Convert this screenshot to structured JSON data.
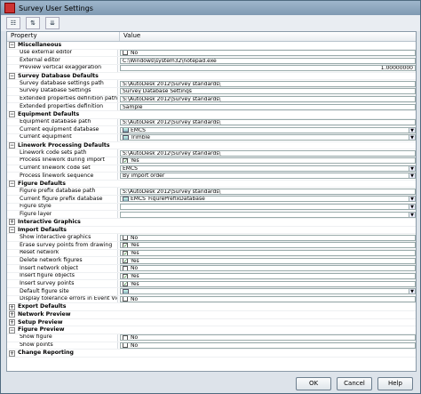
{
  "window": {
    "title": "Survey User Settings"
  },
  "toolbar": {
    "btn1": "☷",
    "btn2": "⇅",
    "btn3": "⇊"
  },
  "grid": {
    "col_property": "Property",
    "col_value": "Value"
  },
  "rows": [
    {
      "type": "cat",
      "label": "Miscellaneous",
      "exp": "−"
    },
    {
      "type": "prop",
      "label": "Use external editor",
      "kind": "check",
      "checked": false,
      "value": "No"
    },
    {
      "type": "prop",
      "label": "External editor",
      "kind": "text",
      "value": "C:\\Windows\\system32\\notepad.exe"
    },
    {
      "type": "prop",
      "label": "Preview vertical exaggeration",
      "kind": "num",
      "value": "1.00000000"
    },
    {
      "type": "cat",
      "label": "Survey Database Defaults",
      "exp": "−"
    },
    {
      "type": "prop",
      "label": "Survey database settings path",
      "kind": "text",
      "value": "S:\\AutoDesk 2012\\Survey standards\\"
    },
    {
      "type": "prop",
      "label": "Survey Database Settings",
      "kind": "text",
      "value": "Survey Database Settings"
    },
    {
      "type": "prop",
      "label": "Extended properties definition path",
      "kind": "text",
      "value": "S:\\AutoDesk 2012\\Survey standards\\"
    },
    {
      "type": "prop",
      "label": "Extended properties definition",
      "kind": "text",
      "value": "Sample"
    },
    {
      "type": "cat",
      "label": "Equipment Defaults",
      "exp": "−"
    },
    {
      "type": "prop",
      "label": "Equipment database path",
      "kind": "text",
      "value": "S:\\AutoDesk 2012\\Survey standards\\"
    },
    {
      "type": "prop",
      "label": "Current equipment database",
      "kind": "icondd",
      "value": "EMCS"
    },
    {
      "type": "prop",
      "label": "Current equipment",
      "kind": "icondd",
      "value": "Trimble"
    },
    {
      "type": "cat",
      "label": "Linework Processing Defaults",
      "exp": "−"
    },
    {
      "type": "prop",
      "label": "Linework code sets path",
      "kind": "text",
      "value": "S:\\AutoDesk 2012\\Survey standards\\"
    },
    {
      "type": "prop",
      "label": "Process linework during import",
      "kind": "check",
      "checked": true,
      "value": "Yes"
    },
    {
      "type": "prop",
      "label": "Current linework code set",
      "kind": "dd",
      "value": "EMCS"
    },
    {
      "type": "prop",
      "label": "Process linework sequence",
      "kind": "dd",
      "value": "By import order"
    },
    {
      "type": "cat",
      "label": "Figure Defaults",
      "exp": "−"
    },
    {
      "type": "prop",
      "label": "Figure prefix database path",
      "kind": "text",
      "value": "S:\\AutoDesk 2012\\Survey standards\\"
    },
    {
      "type": "prop",
      "label": "Current figure prefix database",
      "kind": "icondd",
      "value": "EMCS_FigurePrefixDatabase"
    },
    {
      "type": "prop",
      "label": "Figure style",
      "kind": "dd",
      "value": ""
    },
    {
      "type": "prop",
      "label": "Figure layer",
      "kind": "dd",
      "value": ""
    },
    {
      "type": "cat",
      "label": "Interactive Graphics",
      "exp": "+"
    },
    {
      "type": "cat",
      "label": "Import Defaults",
      "exp": "−"
    },
    {
      "type": "prop",
      "label": "Show interactive graphics",
      "kind": "check",
      "checked": false,
      "value": "No"
    },
    {
      "type": "prop",
      "label": "Erase survey points from drawing",
      "kind": "check",
      "checked": true,
      "value": "Yes"
    },
    {
      "type": "prop",
      "label": "Reset network",
      "kind": "check",
      "checked": true,
      "value": "Yes"
    },
    {
      "type": "prop",
      "label": "Delete network figures",
      "kind": "check",
      "checked": true,
      "value": "Yes"
    },
    {
      "type": "prop",
      "label": "Insert network object",
      "kind": "check",
      "checked": false,
      "value": "No"
    },
    {
      "type": "prop",
      "label": "Insert figure objects",
      "kind": "check",
      "checked": true,
      "value": "Yes"
    },
    {
      "type": "prop",
      "label": "Insert survey points",
      "kind": "check",
      "checked": true,
      "value": "Yes"
    },
    {
      "type": "prop",
      "label": "Default figure site",
      "kind": "icondd",
      "value": ""
    },
    {
      "type": "prop",
      "label": "Display tolerance errors in Event Viewer",
      "kind": "check",
      "checked": false,
      "value": "No"
    },
    {
      "type": "cat",
      "label": "Export Defaults",
      "exp": "+"
    },
    {
      "type": "cat",
      "label": "Network Preview",
      "exp": "+"
    },
    {
      "type": "cat",
      "label": "Setup Preview",
      "exp": "+"
    },
    {
      "type": "cat",
      "label": "Figure Preview",
      "exp": "−"
    },
    {
      "type": "prop",
      "label": "Show figure",
      "kind": "check",
      "checked": false,
      "value": "No"
    },
    {
      "type": "prop",
      "label": "Show points",
      "kind": "check",
      "checked": false,
      "value": "No"
    },
    {
      "type": "cat",
      "label": "Change Reporting",
      "exp": "+"
    }
  ],
  "footer": {
    "ok": "OK",
    "cancel": "Cancel",
    "help": "Help"
  }
}
